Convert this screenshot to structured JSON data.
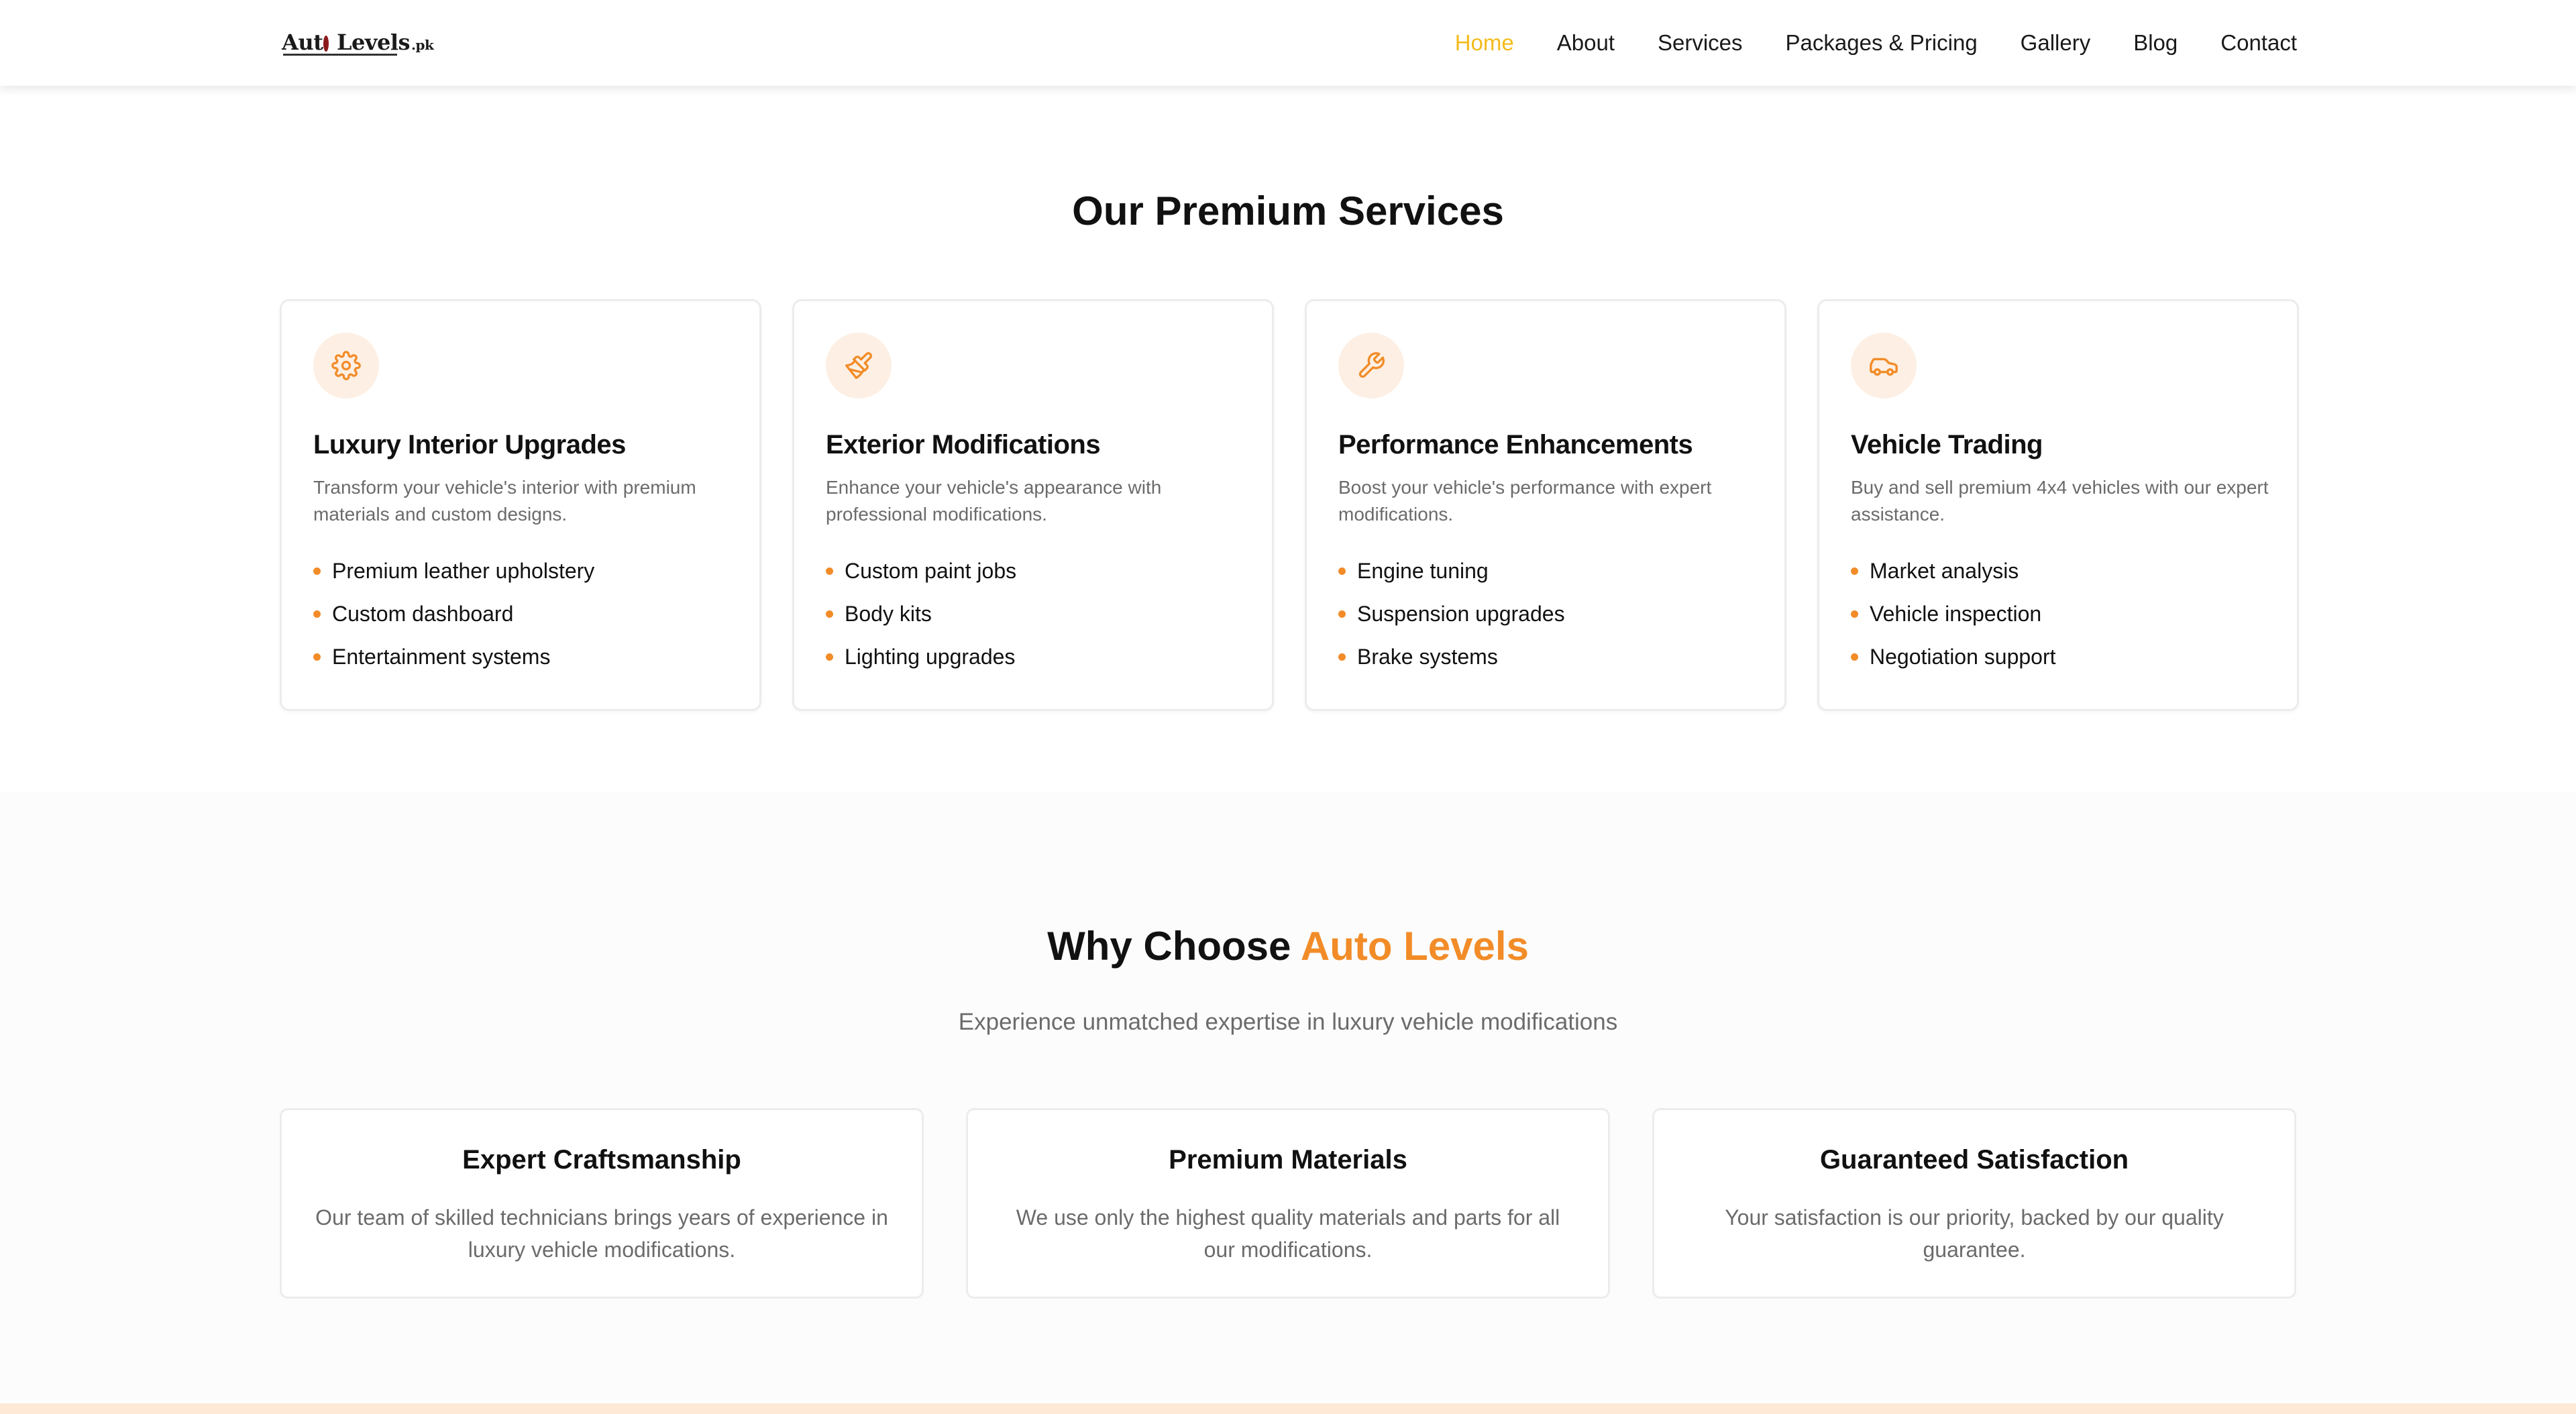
{
  "header": {
    "logo_text_a": "Aut",
    "logo_text_b": "Levels",
    "logo_text_pk": ".pk",
    "nav": [
      {
        "label": "Home",
        "active": true
      },
      {
        "label": "About"
      },
      {
        "label": "Services"
      },
      {
        "label": "Packages & Pricing"
      },
      {
        "label": "Gallery"
      },
      {
        "label": "Blog"
      },
      {
        "label": "Contact"
      }
    ]
  },
  "services": {
    "title": "Our Premium Services",
    "cards": [
      {
        "icon": "gear-icon",
        "title": "Luxury Interior Upgrades",
        "description": "Transform your vehicle's interior with premium materials and custom designs.",
        "items": [
          "Premium leather upholstery",
          "Custom dashboard",
          "Entertainment systems"
        ]
      },
      {
        "icon": "paintbrush-icon",
        "title": "Exterior Modifications",
        "description": "Enhance your vehicle's appearance with professional modifications.",
        "items": [
          "Custom paint jobs",
          "Body kits",
          "Lighting upgrades"
        ]
      },
      {
        "icon": "wrench-icon",
        "title": "Performance Enhancements",
        "description": "Boost your vehicle's performance with expert modifications.",
        "items": [
          "Engine tuning",
          "Suspension upgrades",
          "Brake systems"
        ]
      },
      {
        "icon": "car-icon",
        "title": "Vehicle Trading",
        "description": "Buy and sell premium 4x4 vehicles with our expert assistance.",
        "items": [
          "Market analysis",
          "Vehicle inspection",
          "Negotiation support"
        ]
      }
    ]
  },
  "why": {
    "title_prefix": "Why Choose ",
    "title_accent": "Auto Levels",
    "subtitle": "Experience unmatched expertise in luxury vehicle modifications",
    "features": [
      {
        "title": "Expert Craftsmanship",
        "description": "Our team of skilled technicians brings years of experience in luxury vehicle modifications."
      },
      {
        "title": "Premium Materials",
        "description": "We use only the highest quality materials and parts for all our modifications."
      },
      {
        "title": "Guaranteed Satisfaction",
        "description": "Your satisfaction is our priority, backed by our quality guarantee."
      }
    ]
  },
  "colors": {
    "accent": "#f28c28",
    "nav_active": "#f3bb1b",
    "icon_bg": "#fdefe3",
    "text_muted": "#6b6b6b"
  }
}
